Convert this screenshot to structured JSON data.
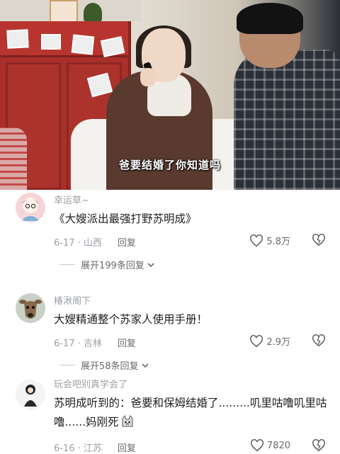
{
  "video": {
    "subtitle": "爸要结婚了你知道吗"
  },
  "comments": [
    {
      "user": "幸运草~",
      "text": "《大嫂派出最强打野苏明成》",
      "date_location": "6-17 · 山西",
      "reply_label": "回复",
      "likes": "5.8万",
      "expand_label": "展开199条回复"
    },
    {
      "user": "椿湫阁下",
      "text": "大嫂精通整个苏家人使用手册！",
      "date_location": "6-17 · 吉林",
      "reply_label": "回复",
      "likes": "2.9万",
      "expand_label": "展开58条回复"
    },
    {
      "user": "玩会吧别真学会了",
      "text": "苏明成听到的：爸要和保姆结婚了.........叽里咕噜叽里咕噜......妈刚死",
      "date_location": "6-16 · 江苏",
      "reply_label": "回复",
      "likes": "7820"
    }
  ],
  "icons": {
    "like": "heart-outline-icon",
    "dislike": "broken-heart-icon",
    "expand": "chevron-down-icon"
  },
  "colors": {
    "meta_gray": "#9aa0a6",
    "text": "#1f1f1f"
  }
}
